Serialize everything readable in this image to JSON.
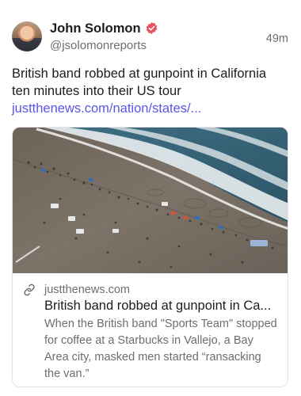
{
  "author": {
    "name": "John Solomon",
    "handle": "@jsolomonreports",
    "verified_color": "#e8525e"
  },
  "post": {
    "time": "49m",
    "text": "British band robbed at gunpoint in California ten minutes into their US tour",
    "link": "justthenews.com/nation/states/..."
  },
  "card": {
    "image_alt": "Aerial view of a crowded beach with people and vehicles near the surf",
    "domain": "justthenews.com",
    "title": "British band robbed at gunpoint in Ca...",
    "description": "When the British band \"Sports Team\" stopped for coffee at a Starbucks in Vallejo, a Bay Area city, masked men started “ransacking the van.”"
  },
  "colors": {
    "link": "#5b54e6",
    "muted": "#6d6d72",
    "text": "#1c1c1c"
  },
  "icons": {
    "verified": "verified-badge-icon",
    "link": "link-icon"
  }
}
